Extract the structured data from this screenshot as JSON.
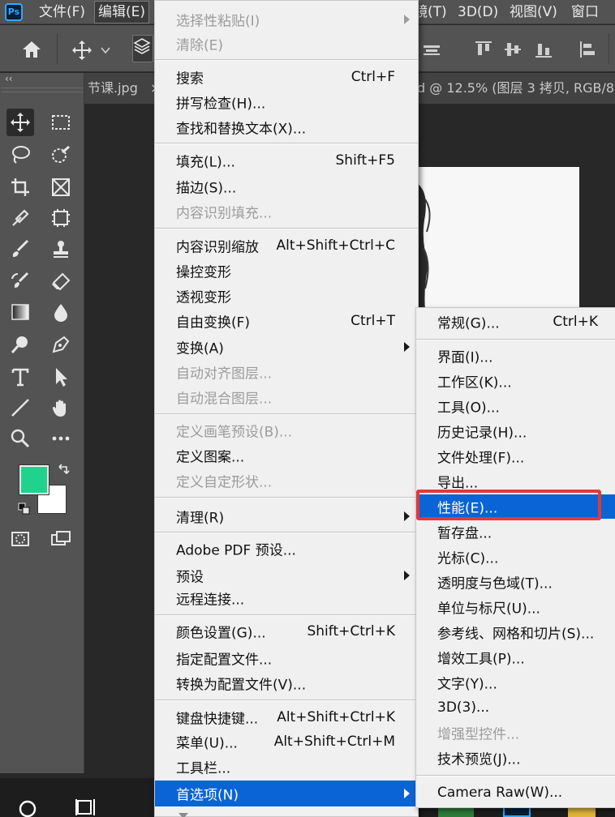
{
  "app": {
    "logo": "Ps"
  },
  "menubar": {
    "items": [
      "文件(F)",
      "编辑(E)"
    ],
    "right_items": [
      "镜(T)",
      "3D(D)",
      "视图(V)",
      "窗口"
    ]
  },
  "doc_tabs": {
    "tab1": "节课.jpg",
    "tab1_close": "×",
    "tab2": "d @ 12.5% (图层 3 拷贝, RGB/8"
  },
  "tools_panel": {
    "collapse": "‹‹"
  },
  "colors": {
    "foreground": "#1fd38c",
    "background": "#ffffff",
    "highlight": "#0a64d6",
    "annotation": "#e03a3a"
  },
  "edit_menu": {
    "g1": [
      {
        "label": "选择性粘贴(I)",
        "shortcut": "",
        "disabled": true,
        "submenu": true
      },
      {
        "label": "清除(E)",
        "shortcut": "",
        "disabled": true
      }
    ],
    "g2": [
      {
        "label": "搜索",
        "shortcut": "Ctrl+F"
      },
      {
        "label": "拼写检查(H)...",
        "shortcut": ""
      },
      {
        "label": "查找和替换文本(X)...",
        "shortcut": ""
      }
    ],
    "g3": [
      {
        "label": "填充(L)...",
        "shortcut": "Shift+F5"
      },
      {
        "label": "描边(S)...",
        "shortcut": ""
      },
      {
        "label": "内容识别填充...",
        "shortcut": "",
        "disabled": true
      }
    ],
    "g4": [
      {
        "label": "内容识别缩放",
        "shortcut": "Alt+Shift+Ctrl+C"
      },
      {
        "label": "操控变形",
        "shortcut": ""
      },
      {
        "label": "透视变形",
        "shortcut": ""
      },
      {
        "label": "自由变换(F)",
        "shortcut": "Ctrl+T"
      },
      {
        "label": "变换(A)",
        "shortcut": "",
        "submenu": true
      },
      {
        "label": "自动对齐图层...",
        "shortcut": "",
        "disabled": true
      },
      {
        "label": "自动混合图层...",
        "shortcut": "",
        "disabled": true
      }
    ],
    "g5": [
      {
        "label": "定义画笔预设(B)...",
        "shortcut": "",
        "disabled": true
      },
      {
        "label": "定义图案...",
        "shortcut": ""
      },
      {
        "label": "定义自定形状...",
        "shortcut": "",
        "disabled": true
      }
    ],
    "g6": [
      {
        "label": "清理(R)",
        "shortcut": "",
        "submenu": true
      }
    ],
    "g7": [
      {
        "label": "Adobe PDF 预设...",
        "shortcut": ""
      },
      {
        "label": "预设",
        "shortcut": "",
        "submenu": true
      },
      {
        "label": "远程连接...",
        "shortcut": ""
      }
    ],
    "g8": [
      {
        "label": "颜色设置(G)...",
        "shortcut": "Shift+Ctrl+K"
      },
      {
        "label": "指定配置文件...",
        "shortcut": ""
      },
      {
        "label": "转换为配置文件(V)...",
        "shortcut": ""
      }
    ],
    "g9": [
      {
        "label": "键盘快捷键...",
        "shortcut": "Alt+Shift+Ctrl+K"
      },
      {
        "label": "菜单(U)...",
        "shortcut": "Alt+Shift+Ctrl+M"
      },
      {
        "label": "工具栏...",
        "shortcut": ""
      },
      {
        "label": "首选项(N)",
        "shortcut": "",
        "submenu": true,
        "highlighted": true
      }
    ]
  },
  "preferences_submenu": {
    "top": {
      "label": "常规(G)...",
      "shortcut": "Ctrl+K"
    },
    "items": [
      {
        "label": "界面(I)..."
      },
      {
        "label": "工作区(K)..."
      },
      {
        "label": "工具(O)..."
      },
      {
        "label": "历史记录(H)..."
      },
      {
        "label": "文件处理(F)..."
      },
      {
        "label": "导出..."
      },
      {
        "label": "性能(E)...",
        "highlighted": true
      },
      {
        "label": "暂存盘..."
      },
      {
        "label": "光标(C)..."
      },
      {
        "label": "透明度与色域(T)..."
      },
      {
        "label": "单位与标尺(U)..."
      },
      {
        "label": "参考线、网格和切片(S)..."
      },
      {
        "label": "增效工具(P)..."
      },
      {
        "label": "文字(Y)..."
      },
      {
        "label": "3D(3)..."
      },
      {
        "label": "增强型控件...",
        "disabled": true
      },
      {
        "label": "技术预览(J)..."
      }
    ],
    "bottom": {
      "label": "Camera Raw(W)..."
    }
  }
}
